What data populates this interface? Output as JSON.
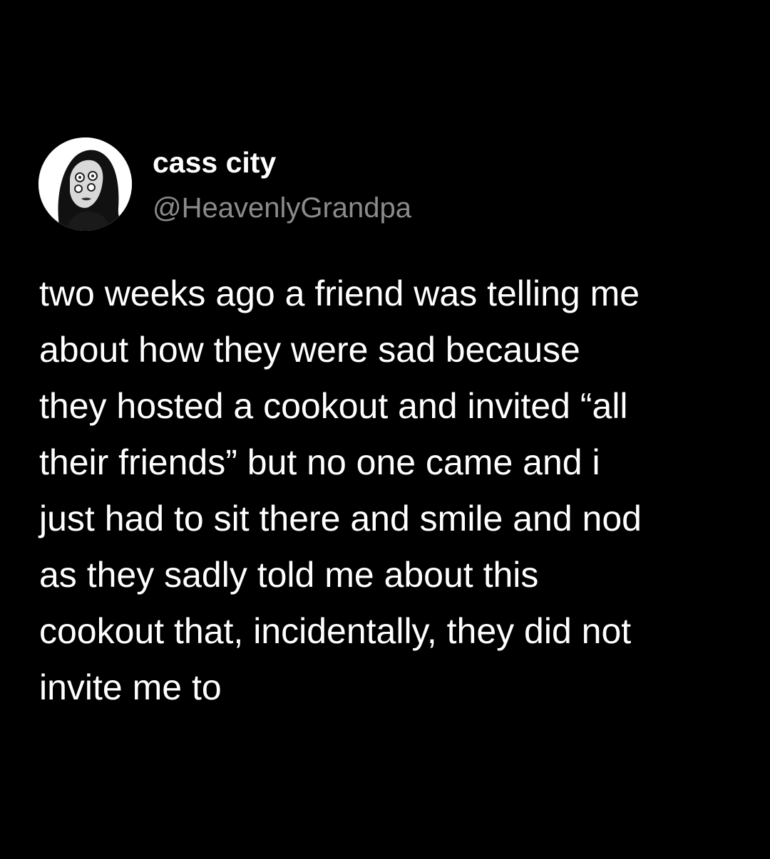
{
  "author": {
    "display_name": "cass city",
    "handle": "@HeavenlyGrandpa",
    "avatar": "profile-photo-avatar"
  },
  "tweet": {
    "lines": [
      "two weeks ago a friend was telling me",
      "about how they were sad because",
      "they hosted a cookout and invited “all",
      "their friends” but no one came and i",
      "just had to sit there and smile and nod",
      "as they sadly told me about this",
      "cookout that, incidentally, they did not",
      "invite me to"
    ]
  },
  "colors": {
    "background": "#000000",
    "text_primary": "#ffffff",
    "text_secondary": "#8b8b8b"
  }
}
